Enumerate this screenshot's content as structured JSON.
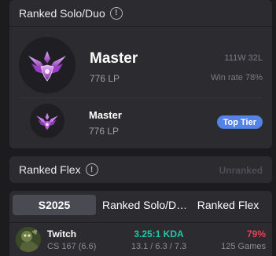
{
  "solo": {
    "title": "Ranked Solo/Duo",
    "tier": "Master",
    "lp": "776 LP",
    "record": "111W 32L",
    "win_rate": "Win rate 78%",
    "peak_tier": "Master",
    "peak_lp": "776 LP",
    "badge": "Top Tier"
  },
  "flex": {
    "title": "Ranked Flex",
    "status": "Unranked"
  },
  "tabs": [
    {
      "label": "S2025"
    },
    {
      "label": "Ranked Solo/D…"
    },
    {
      "label": "Ranked Flex"
    }
  ],
  "champions": [
    {
      "name": "Twitch",
      "cs": "CS 167 (6.6)",
      "kda": "3.25:1 KDA",
      "kda_detail": "13.1 / 6.3 / 7.3",
      "win_rate": "79%",
      "games": "125 Games"
    }
  ],
  "icons": {
    "info": "info-circle-icon",
    "emblem": "master-emblem-icon",
    "champion": "twitch-portrait"
  },
  "colors": {
    "badge": "#5383e8",
    "kda": "#28c4a8",
    "win_rate": "#e84057",
    "emblem": "#b35bd8"
  }
}
